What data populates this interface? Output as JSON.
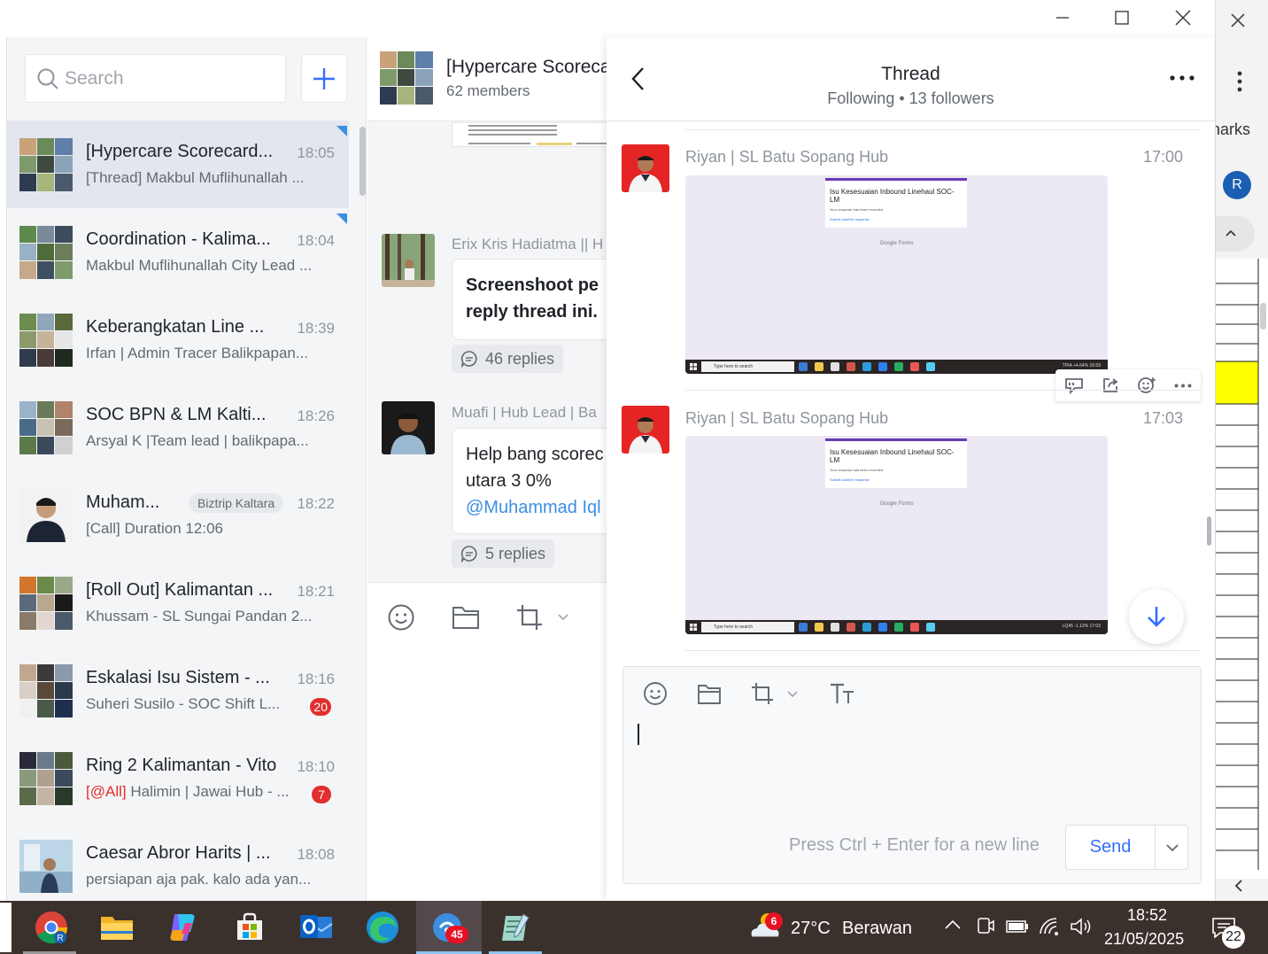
{
  "window": {
    "controls": [
      "minimize",
      "maximize",
      "close"
    ]
  },
  "background_app": {
    "partial_text": "narks",
    "avatar_initial": "R",
    "highlight_color": "#ffff00"
  },
  "sidebar": {
    "search_placeholder": "Search",
    "chats": [
      {
        "name": "[Hypercare Scorecard...",
        "time": "18:05",
        "preview": "[Thread] Makbul Muflihunallah ...",
        "active": true
      },
      {
        "name": "Coordination - Kalima...",
        "time": "18:04",
        "preview": "Makbul Muflihunallah City Lead ..."
      },
      {
        "name": "Keberangkatan Line ...",
        "time": "18:39",
        "preview": "Irfan | Admin Tracer Balikpapan..."
      },
      {
        "name": "SOC BPN & LM Kalti...",
        "time": "18:26",
        "preview": "Arsyal K |Team lead | balikpapa..."
      },
      {
        "name": "Muham...",
        "tag": "Biztrip Kaltara",
        "time": "18:22",
        "preview": "[Call] Duration 12:06"
      },
      {
        "name": "[Roll Out] Kalimantan ...",
        "time": "18:21",
        "preview": "Khussam - SL Sungai Pandan 2..."
      },
      {
        "name": "Eskalasi Isu Sistem - ...",
        "time": "18:16",
        "preview": "Suheri Susilo - SOC Shift L...",
        "badge": "20"
      },
      {
        "name": "Ring 2 Kalimantan - Vito",
        "time": "18:10",
        "mention": "[@All]",
        "preview": " Halimin | Jawai Hub - ...",
        "badge": "7"
      },
      {
        "name": "Caesar Abror Harits | ...",
        "time": "18:08",
        "preview": "persiapan aja pak. kalo ada yan..."
      }
    ]
  },
  "group": {
    "title": "[Hypercare Scoreca",
    "members": "62 members",
    "messages": [
      {
        "sender": "Erix Kris Hadiatma || H",
        "line1": "Screenshoot pe",
        "line2": "reply thread ini.",
        "replies": "46 replies"
      },
      {
        "sender": "Muafi | Hub Lead | Ba",
        "line1": "Help bang scorec",
        "line2": "utara 3 0%",
        "line3": "@Muhammad Iql",
        "replies": "5 replies"
      }
    ]
  },
  "thread": {
    "title": "Thread",
    "subtitle": "Following • 13 followers",
    "messages": [
      {
        "sender": "Riyan | SL Batu Sopang Hub",
        "time": "17:00",
        "screenshot": {
          "form_title": "Isu Kesesuaian Inbound Linehaul SOC-LM",
          "form_status": "Your response has been recorded",
          "form_link": "Submit another response",
          "footer": "Google Forms",
          "taskbar_search": "Type here to search",
          "ticker": "TPIA +4.64%",
          "clock": "16:59"
        }
      },
      {
        "sender": "Riyan | SL Batu Sopang Hub",
        "time": "17:03",
        "screenshot": {
          "form_title": "Isu Kesesuaian Inbound Linehaul SOC-LM",
          "form_status": "Your response has been recorded",
          "form_link": "Submit another response",
          "footer": "Google Forms",
          "taskbar_search": "Type here to search",
          "ticker": "LQ45 -1.12%",
          "clock": "17:03"
        }
      }
    ],
    "composer_hint": "Press Ctrl + Enter for a new line",
    "send_label": "Send"
  },
  "taskbar": {
    "weather_temp": "27°C",
    "weather_desc": "Berawan",
    "weather_alert": "6",
    "chat_badge": "45",
    "time": "18:52",
    "date": "21/05/2025",
    "notification_count": "22"
  }
}
